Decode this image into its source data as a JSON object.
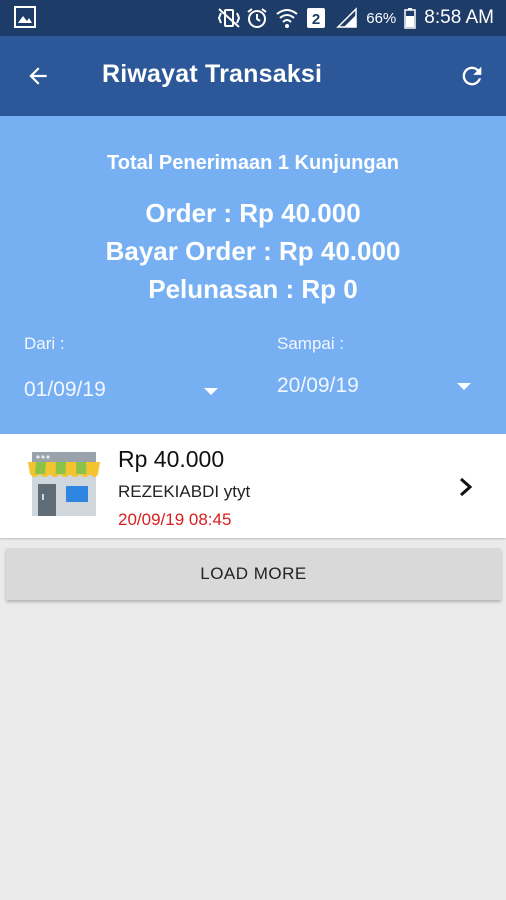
{
  "status_bar": {
    "battery_percent": "66%",
    "time": "8:58 AM",
    "icons": [
      "image-icon",
      "mute-vibrate-icon",
      "alarm-icon",
      "wifi-icon",
      "sim-2-icon",
      "signal-icon",
      "battery-icon"
    ]
  },
  "app_bar": {
    "title": "Riwayat Transaksi",
    "back_icon": "arrow-back-icon",
    "refresh_icon": "refresh-icon",
    "color": "#2c5798"
  },
  "summary": {
    "title": "Total Penerimaan 1 Kunjungan",
    "order": "Order : Rp 40.000",
    "bayar_order": "Bayar Order : Rp 40.000",
    "pelunasan": "Pelunasan : Rp 0",
    "from_label": "Dari :",
    "from_value": "01/09/19",
    "to_label": "Sampai :",
    "to_value": "20/09/19",
    "color": "#77b0f2"
  },
  "transactions": [
    {
      "amount": "Rp 40.000",
      "customer": "REZEKIABDI ytyt",
      "datetime": "20/09/19 08:45",
      "icon": "store-icon"
    }
  ],
  "load_more_label": "LOAD MORE"
}
